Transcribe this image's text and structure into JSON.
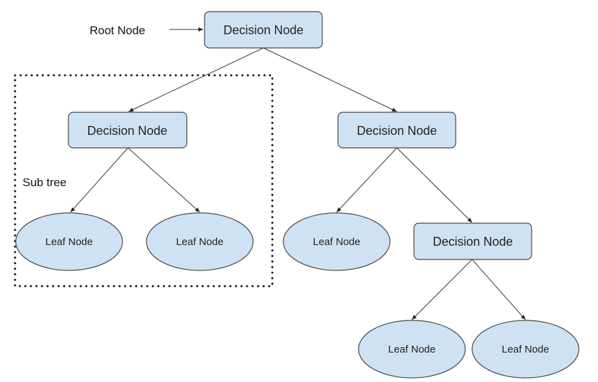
{
  "colors": {
    "node_fill": "#cfe2f3",
    "node_stroke": "#444444"
  },
  "labels": {
    "root": "Root Node",
    "subtree": "Sub tree"
  },
  "nodes": {
    "root": "Decision Node",
    "left_decision": "Decision Node",
    "right_decision": "Decision Node",
    "leaf_1": "Leaf Node",
    "leaf_2": "Leaf Node",
    "leaf_3": "Leaf Node",
    "lower_decision": "Decision Node",
    "leaf_4": "Leaf Node",
    "leaf_5": "Leaf Node"
  }
}
